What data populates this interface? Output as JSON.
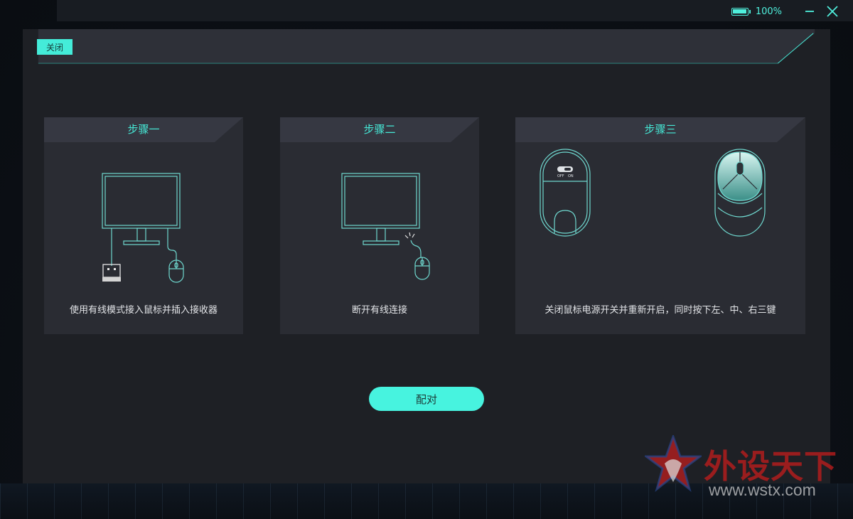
{
  "titlebar": {
    "battery_percent": "100%",
    "battery_level": 1.0
  },
  "dialog": {
    "close_label": "关闭",
    "pair_label": "配对",
    "steps": [
      {
        "title": "步骤一",
        "description": "使用有线模式接入鼠标并插入接收器"
      },
      {
        "title": "步骤二",
        "description": "断开有线连接"
      },
      {
        "title": "步骤三",
        "description": "关闭鼠标电源开关并重新开启，同时按下左、中、右三键",
        "switch_off": "OFF",
        "switch_on": "ON"
      }
    ]
  },
  "watermark": {
    "cn": "外设天下",
    "url": "www.wstx.com"
  },
  "colors": {
    "accent": "#46e8d6",
    "dialog_bg": "#1e2025",
    "card_bg": "#2a2c33"
  },
  "icons": [
    "battery-icon",
    "minimize-icon",
    "close-window-icon",
    "monitor-icon",
    "usb-receiver-icon",
    "mouse-icon",
    "mouse-bottom-icon",
    "mouse-top-icon"
  ]
}
